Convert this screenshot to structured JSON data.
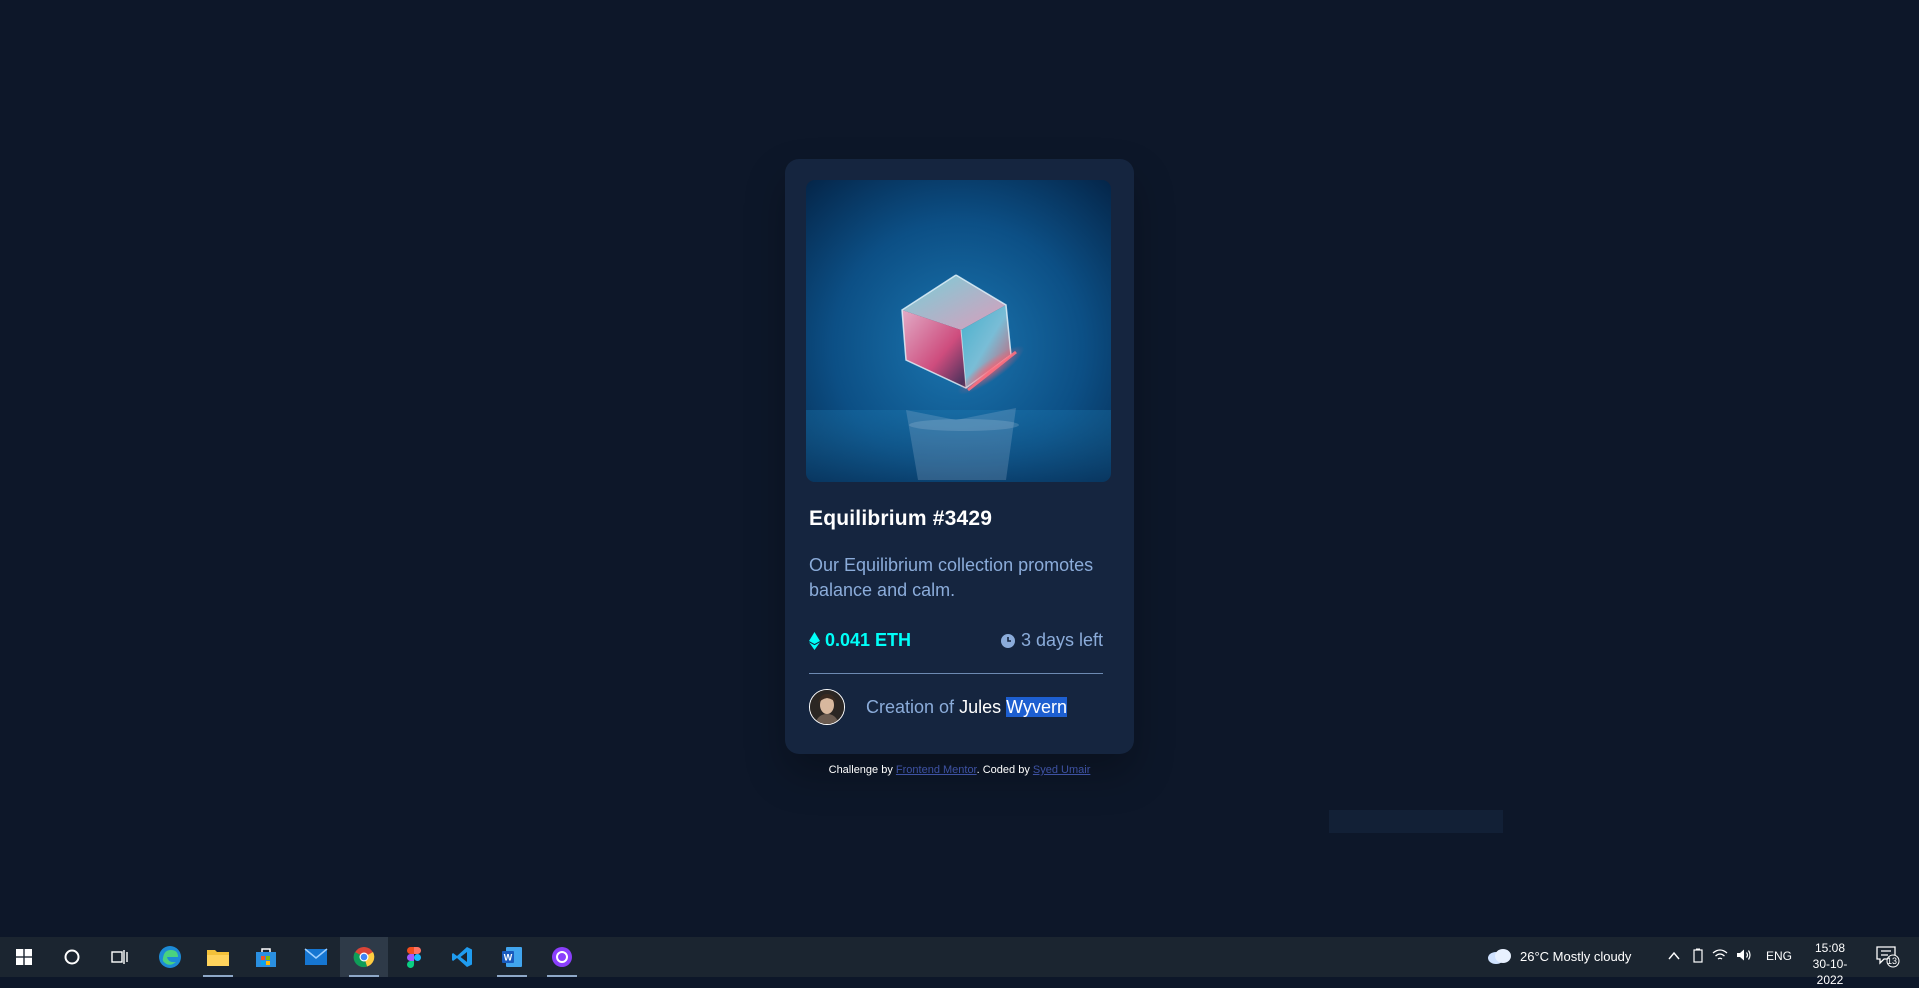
{
  "card": {
    "title": "Equilibrium #3429",
    "description": "Our Equilibrium collection promotes balance and calm.",
    "price": "0.041 ETH",
    "time_left": "3 days left",
    "creator_prefix": "Creation of",
    "creator_first": "Jules",
    "creator_selected": "Wyvern"
  },
  "attribution": {
    "challenge_prefix": "Challenge by",
    "challenge_link": "Frontend Mentor",
    "coded_prefix": ". Coded by",
    "coded_link": "Syed Umair"
  },
  "taskbar": {
    "apps": [
      "windows-start",
      "cortana-search",
      "task-view",
      "microsoft-edge",
      "file-explorer",
      "microsoft-store",
      "mail",
      "google-chrome",
      "figma",
      "visual-studio-code",
      "microsoft-word",
      "github-desktop"
    ],
    "weather": "26°C  Mostly cloudy",
    "language": "ENG",
    "time": "15:08",
    "date": "30-10-2022",
    "notifications": "13"
  },
  "colors": {
    "page_bg": "#0d1729",
    "card_bg": "#15253f",
    "cyan": "#00fff8",
    "soft_blue": "#8bacda",
    "white": "#ffffff"
  }
}
